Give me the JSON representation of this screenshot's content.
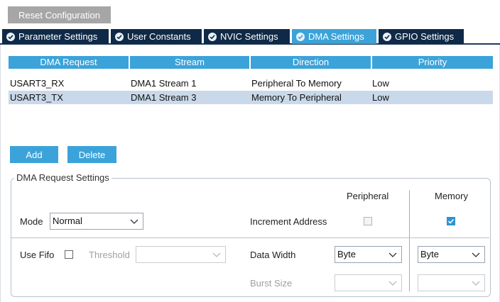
{
  "toolbar": {
    "reset_label": "Reset Configuration"
  },
  "tabs": [
    {
      "label": "Parameter Settings",
      "active": false
    },
    {
      "label": "User Constants",
      "active": false
    },
    {
      "label": "NVIC Settings",
      "active": false
    },
    {
      "label": "DMA Settings",
      "active": true
    },
    {
      "label": "GPIO Settings",
      "active": false
    }
  ],
  "table": {
    "headers": [
      "DMA Request",
      "Stream",
      "Direction",
      "Priority"
    ],
    "rows": [
      {
        "request": "USART3_RX",
        "stream": "DMA1 Stream 1",
        "direction": "Peripheral To Memory",
        "priority": "Low",
        "selected": false
      },
      {
        "request": "USART3_TX",
        "stream": "DMA1 Stream 3",
        "direction": "Memory To Peripheral",
        "priority": "Low",
        "selected": true
      }
    ]
  },
  "actions": {
    "add_label": "Add",
    "delete_label": "Delete"
  },
  "settings": {
    "legend": "DMA Request Settings",
    "peripheral_header": "Peripheral",
    "memory_header": "Memory",
    "mode_label": "Mode",
    "mode_value": "Normal",
    "increment_label": "Increment Address",
    "increment_peripheral": false,
    "increment_memory": true,
    "use_fifo_label": "Use Fifo",
    "use_fifo": false,
    "threshold_label": "Threshold",
    "threshold_value": "",
    "data_width_label": "Data Width",
    "data_width_peripheral": "Byte",
    "data_width_memory": "Byte",
    "burst_size_label": "Burst Size",
    "burst_peripheral": "",
    "burst_memory": ""
  },
  "colors": {
    "accent": "#3ba3d9",
    "tab_dark": "#0f2a47",
    "selected_row": "#c9d9ea",
    "reset_button": "#a6a6a6"
  }
}
